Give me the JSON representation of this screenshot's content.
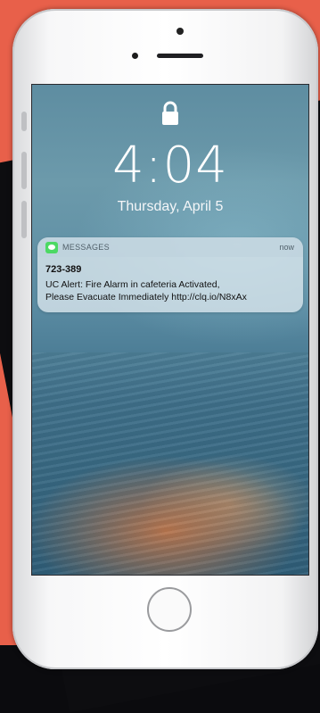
{
  "lock_screen": {
    "time": "4:04",
    "date": "Thursday, April 5"
  },
  "notification": {
    "app_name": "MESSAGES",
    "timestamp": "now",
    "sender": "723-389",
    "message_line1": "UC Alert: Fire Alarm in cafeteria Activated,",
    "message_line2": "Please Evacuate Immediately http://clq.io/N8xAx"
  },
  "icons": {
    "lock": "lock-icon",
    "app": "messages-app-icon",
    "home": "home-button"
  },
  "colors": {
    "background_accent": "#e8604a",
    "messages_green": "#4cd964",
    "phone_body": "#f7f7f8"
  }
}
